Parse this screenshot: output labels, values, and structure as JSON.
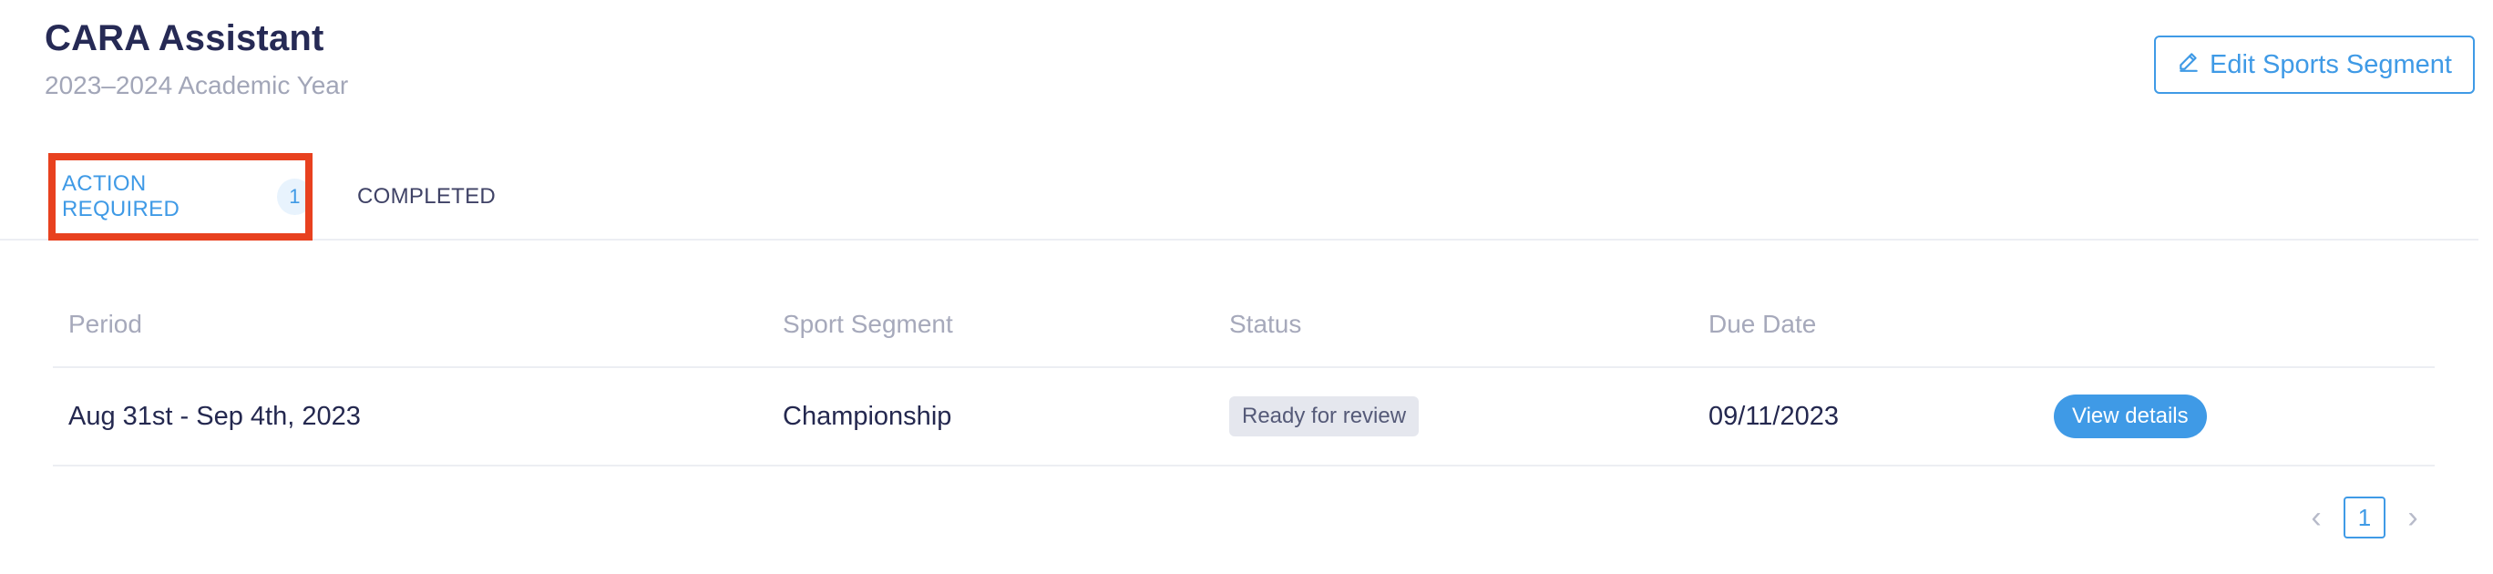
{
  "header": {
    "title": "CARA Assistant",
    "subtitle": "2023–2024 Academic Year",
    "edit_button_label": "Edit Sports Segment",
    "edit_icon": "pencil-icon"
  },
  "tabs": [
    {
      "label": "ACTION REQUIRED",
      "count": "1",
      "active": true,
      "highlighted": true
    },
    {
      "label": "COMPLETED",
      "active": false
    }
  ],
  "table": {
    "columns": [
      "Period",
      "Sport Segment",
      "Status",
      "Due Date"
    ],
    "rows": [
      {
        "period": "Aug 31st - Sep 4th, 2023",
        "sport_segment": "Championship",
        "status": "Ready for review",
        "due_date": "09/11/2023",
        "action_label": "View details"
      }
    ]
  },
  "pagination": {
    "current_page": "1",
    "prev_icon": "chevron-left-icon",
    "next_icon": "chevron-right-icon"
  },
  "colors": {
    "accent": "#3f9ae6",
    "highlight_outline": "#e8411f",
    "title": "#262a55",
    "muted": "#a6a9bb"
  }
}
